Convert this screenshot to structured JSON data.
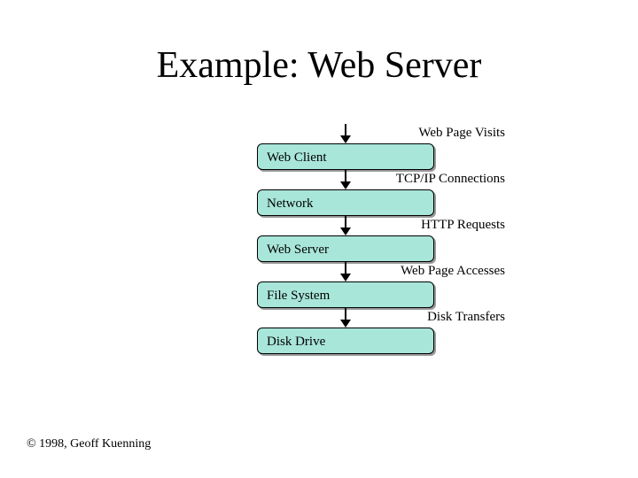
{
  "title": "Example: Web Server",
  "flows": [
    {
      "label": "Web Page Visits",
      "box": "Web Client"
    },
    {
      "label": "TCP/IP Connections",
      "box": "Network"
    },
    {
      "label": "HTTP Requests",
      "box": "Web Server"
    },
    {
      "label": "Web Page Accesses",
      "box": "File System"
    },
    {
      "label": "Disk Transfers",
      "box": "Disk Drive"
    }
  ],
  "footer": "© 1998, Geoff Kuenning"
}
